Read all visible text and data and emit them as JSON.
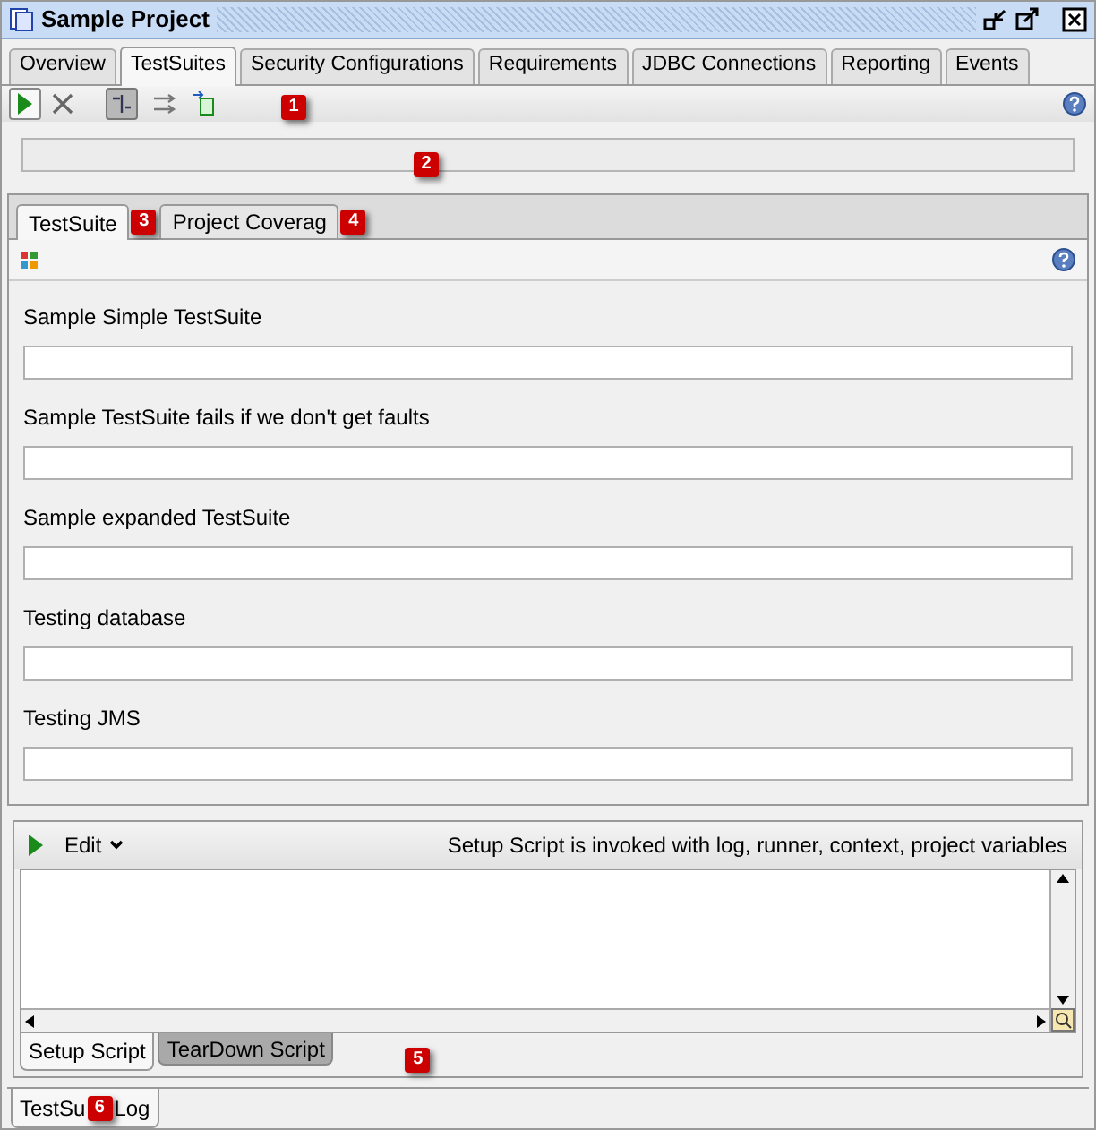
{
  "window": {
    "title": "Sample Project"
  },
  "tabs": [
    {
      "label": "Overview",
      "selected": false
    },
    {
      "label": "TestSuites",
      "selected": true
    },
    {
      "label": "Security Configurations",
      "selected": false
    },
    {
      "label": "Requirements",
      "selected": false
    },
    {
      "label": "JDBC Connections",
      "selected": false
    },
    {
      "label": "Reporting",
      "selected": false
    },
    {
      "label": "Events",
      "selected": false
    }
  ],
  "toolbar": {
    "sequential_toggle": {
      "on": true
    },
    "parallel_toggle": {
      "on": false
    }
  },
  "progress": {
    "level": 0
  },
  "inner_tabs": [
    {
      "label": "TestSuite",
      "selected": true
    },
    {
      "label": "Project Coverag",
      "selected": false
    }
  ],
  "test_suites": [
    {
      "name": "Sample Simple TestSuite",
      "level": 0
    },
    {
      "name": "Sample TestSuite fails if we don't get faults",
      "level": 0
    },
    {
      "name": "Sample expanded TestSuite",
      "level": 0
    },
    {
      "name": "Testing database",
      "level": 0
    },
    {
      "name": "Testing JMS",
      "level": 0
    }
  ],
  "script_panel": {
    "menu": "Edit",
    "info": "Setup Script is invoked with log, runner, context, project variables",
    "tabs": [
      {
        "label": "Setup Script",
        "selected": true
      },
      {
        "label": "TearDown Script",
        "selected": false
      }
    ]
  },
  "log_tab": {
    "label_start": "TestSu",
    "label_end": "Log",
    "selected": true
  },
  "callouts": [
    "1",
    "2",
    "3",
    "4",
    "5",
    "6"
  ]
}
